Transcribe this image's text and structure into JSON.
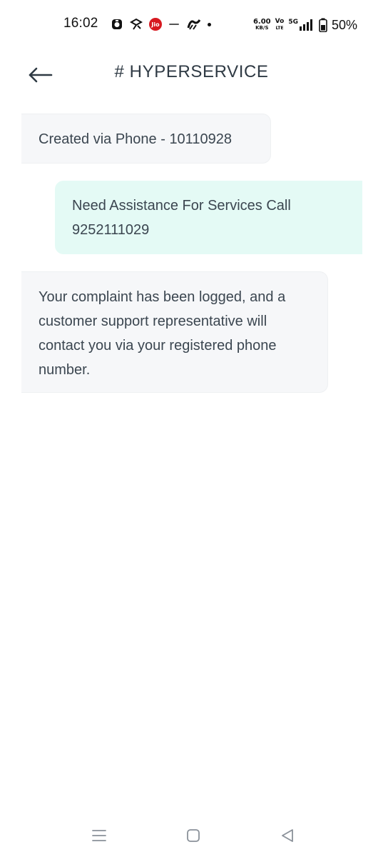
{
  "status_bar": {
    "time": "16:02",
    "jio_label": "Jio",
    "net_speed_value": "6.00",
    "net_speed_unit": "KB/S",
    "volte_top": "Vo",
    "volte_bottom": "LTE",
    "network_type": "5G",
    "battery_percent": "50%"
  },
  "header": {
    "title": "# HYPERSERVICE"
  },
  "messages": [
    {
      "direction": "incoming",
      "text": "Created via Phone - 10110928"
    },
    {
      "direction": "outgoing",
      "text": "Need Assistance For Services Call 9252111029"
    },
    {
      "direction": "incoming",
      "text": "Your complaint has been logged, and a customer support representative will contact you via your registered phone number."
    }
  ],
  "colors": {
    "incoming_bubble": "#f6f7f9",
    "outgoing_bubble": "#e4faf5",
    "text": "#3b4650"
  },
  "icons": {
    "back": "arrow-left-icon",
    "nav_menu": "menu-icon",
    "nav_home": "home-square-icon",
    "nav_back": "back-triangle-icon"
  }
}
